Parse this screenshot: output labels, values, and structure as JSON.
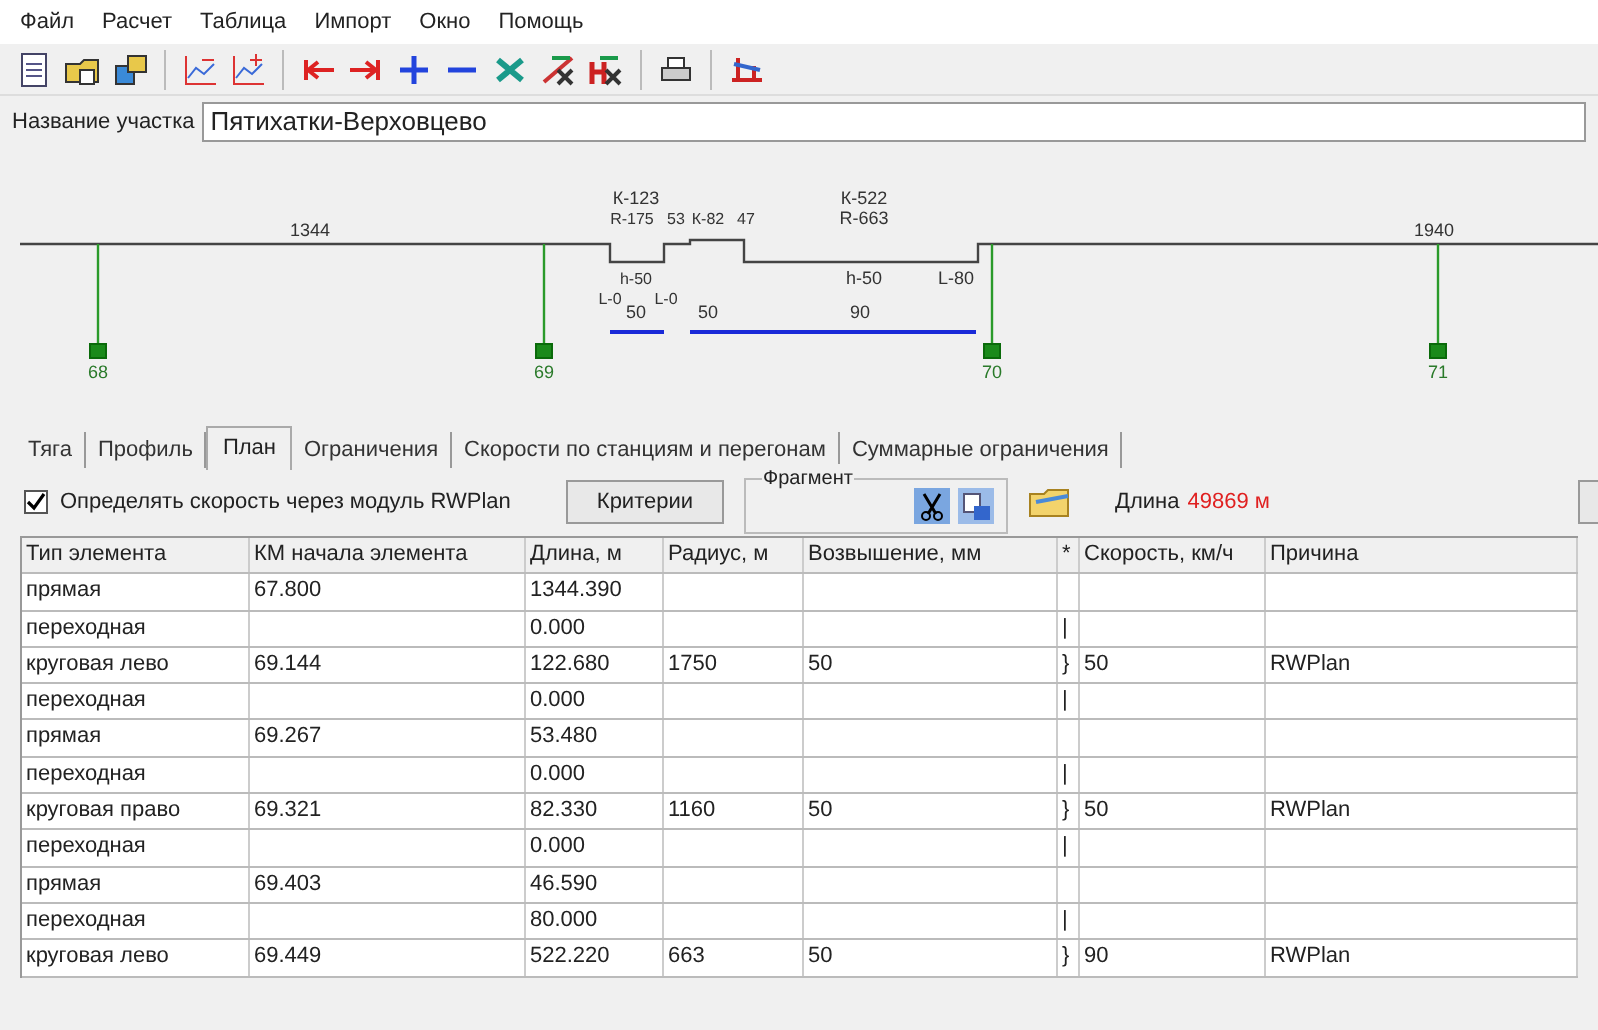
{
  "menu": [
    "Файл",
    "Расчет",
    "Таблица",
    "Импорт",
    "Окно",
    "Помощь"
  ],
  "section_name": {
    "label": "Название участка",
    "value": "Пятихатки-Верховцево"
  },
  "diagram": {
    "labels": [
      "1344",
      "К-123",
      "R-175",
      "h-50",
      "53",
      "К-82",
      "47",
      "К-522",
      "R-663",
      "h-50",
      "L-0",
      "L-0",
      "L-80",
      "50",
      "50",
      "90",
      "68",
      "69",
      "70",
      "71",
      "1940"
    ]
  },
  "tabs": [
    {
      "label": "Тяга",
      "selected": false
    },
    {
      "label": "Профиль",
      "selected": false
    },
    {
      "label": "План",
      "selected": true
    },
    {
      "label": "Ограничения",
      "selected": false
    },
    {
      "label": "Скорости по станциям и перегонам",
      "selected": false
    },
    {
      "label": "Суммарные ограничения",
      "selected": false
    }
  ],
  "rwplan_checkbox": {
    "label": "Определять скорость через модуль RWPlan",
    "checked": true
  },
  "criteria_button": "Критерии",
  "fragment_group": "Фрагмент",
  "length": {
    "label": "Длина",
    "value": "49869 м"
  },
  "table": {
    "columns": [
      "Тип элемента",
      "КМ начала элемента",
      "Длина, м",
      "Радиус, м",
      "Возвышение, мм",
      "*",
      "Скорость, км/ч",
      "Причина"
    ],
    "rows": [
      [
        "прямая",
        "67.800",
        "1344.390",
        "",
        "",
        "",
        "",
        ""
      ],
      [
        "переходная",
        "",
        "0.000",
        "",
        "",
        "|",
        "",
        ""
      ],
      [
        "круговая лево",
        "69.144",
        "122.680",
        "1750",
        "50",
        "}",
        "50",
        "RWPlan"
      ],
      [
        "переходная",
        "",
        "0.000",
        "",
        "",
        "|",
        "",
        ""
      ],
      [
        "прямая",
        "69.267",
        "53.480",
        "",
        "",
        "",
        "",
        ""
      ],
      [
        "переходная",
        "",
        "0.000",
        "",
        "",
        "|",
        "",
        ""
      ],
      [
        "круговая право",
        "69.321",
        "82.330",
        "1160",
        "50",
        "}",
        "50",
        "RWPlan"
      ],
      [
        "переходная",
        "",
        "0.000",
        "",
        "",
        "|",
        "",
        ""
      ],
      [
        "прямая",
        "69.403",
        "46.590",
        "",
        "",
        "",
        "",
        ""
      ],
      [
        "переходная",
        "",
        "80.000",
        "",
        "",
        "|",
        "",
        ""
      ],
      [
        "круговая лево",
        "69.449",
        "522.220",
        "663",
        "50",
        "}",
        "90",
        "RWPlan"
      ]
    ]
  }
}
